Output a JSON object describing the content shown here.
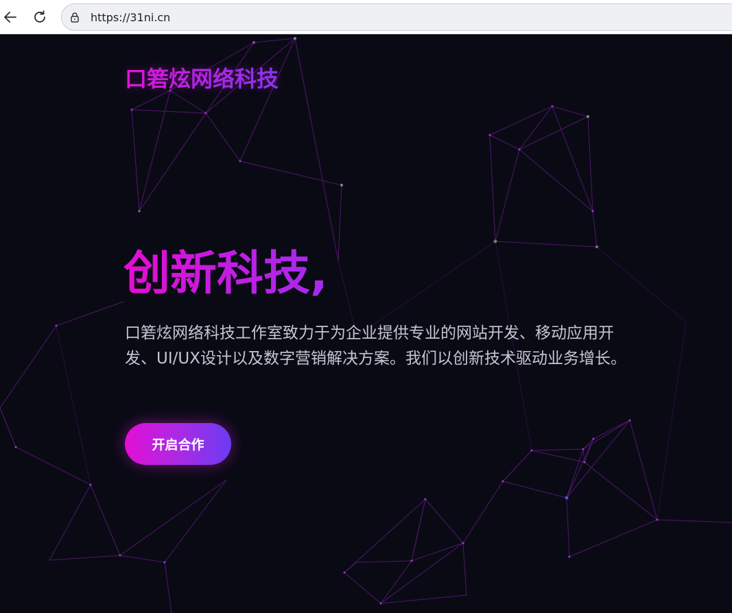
{
  "browser": {
    "url": "https://31ni.cn",
    "back_icon": "arrow-left-icon",
    "reload_icon": "reload-icon",
    "lock_icon": "lock-icon"
  },
  "site": {
    "brand": "口箬炫网络科技"
  },
  "hero": {
    "title": "创新科技,",
    "description": "口箬炫网络科技工作室致力于为企业提供专业的网站开发、移动应用开发、UI/UX设计以及数字营销解决方案。我们以创新技术驱动业务增长。",
    "cta_label": "开启合作"
  },
  "colors": {
    "page_background": "#0a0a15",
    "accent_magenta": "#e514d4",
    "accent_purple": "#7c3af0",
    "text_muted": "#c6c6d2"
  }
}
